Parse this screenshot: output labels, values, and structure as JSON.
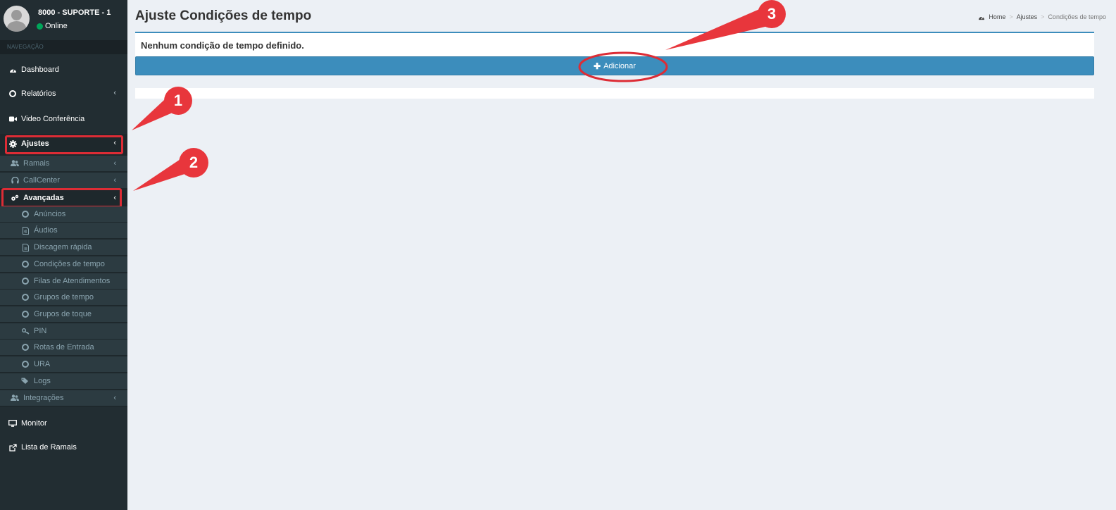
{
  "user": {
    "name": "8000 - SUPORTE - 1",
    "status": "Online"
  },
  "nav": {
    "header": "NAVEGAÇÃO",
    "items": [
      {
        "label": "Dashboard",
        "icon": "dashboard-icon"
      },
      {
        "label": "Relatórios",
        "icon": "circle-icon"
      },
      {
        "label": "Video Conferência",
        "icon": "video-camera-icon"
      },
      {
        "label": "Ajustes",
        "icon": "gear-icon"
      },
      {
        "label": "Monitor",
        "icon": "desktop-icon"
      },
      {
        "label": "Lista de Ramais",
        "icon": "external-link-icon"
      }
    ],
    "ajustes_sub": [
      {
        "label": "Ramais",
        "icon": "users-icon"
      },
      {
        "label": "CallCenter",
        "icon": "headset-icon"
      },
      {
        "label": "Avançadas",
        "icon": "gears-icon"
      },
      {
        "label": "Integrações",
        "icon": "users-icon"
      }
    ],
    "avancadas_sub": [
      {
        "label": "Anúncios",
        "icon": "circle-icon"
      },
      {
        "label": "Áudios",
        "icon": "audio-file-icon"
      },
      {
        "label": "Discagem rápida",
        "icon": "file-icon"
      },
      {
        "label": "Condições de tempo",
        "icon": "circle-icon"
      },
      {
        "label": "Filas de Atendimentos",
        "icon": "circle-icon"
      },
      {
        "label": "Grupos de tempo",
        "icon": "circle-icon"
      },
      {
        "label": "Grupos de toque",
        "icon": "circle-icon"
      },
      {
        "label": "PIN",
        "icon": "key-icon"
      },
      {
        "label": "Rotas de Entrada",
        "icon": "circle-icon"
      },
      {
        "label": "URA",
        "icon": "circle-icon"
      },
      {
        "label": "Logs",
        "icon": "tags-icon"
      }
    ]
  },
  "page": {
    "title": "Ajuste Condições de tempo",
    "breadcrumb": {
      "home": "Home",
      "section": "Ajustes",
      "current": "Condições de tempo"
    },
    "empty_message": "Nenhum condição de tempo definido.",
    "add_button": "Adicionar"
  },
  "annotations": [
    "1",
    "2",
    "3"
  ],
  "colors": {
    "sidebar": "#222d32",
    "primary": "#3c8dbc",
    "annotation": "#e8363c",
    "online": "#00a65a"
  }
}
